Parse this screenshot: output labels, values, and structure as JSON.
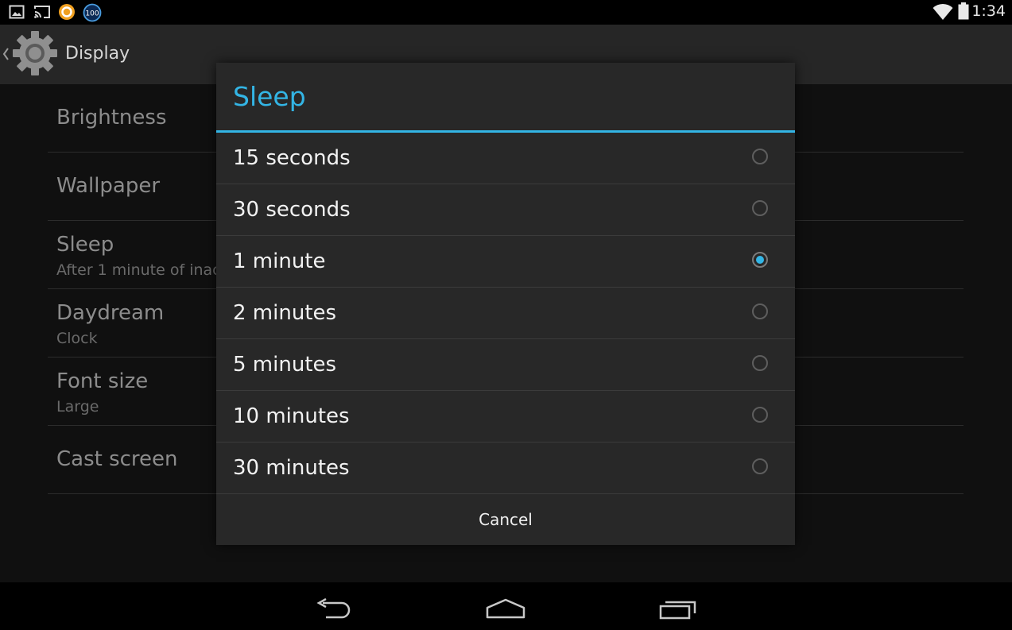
{
  "status_bar": {
    "time": "1:34",
    "left_icons": [
      "gallery-icon",
      "cast-icon",
      "app-ring-icon",
      "battery-100-badge-icon"
    ],
    "badge_text": "100",
    "right_icons": [
      "wifi-icon",
      "battery-icon"
    ]
  },
  "action_bar": {
    "title": "Display",
    "icon": "settings-gear-icon"
  },
  "settings": {
    "items": [
      {
        "title": "Brightness",
        "subtitle": ""
      },
      {
        "title": "Wallpaper",
        "subtitle": ""
      },
      {
        "title": "Sleep",
        "subtitle": "After 1 minute of inac"
      },
      {
        "title": "Daydream",
        "subtitle": "Clock"
      },
      {
        "title": "Font size",
        "subtitle": "Large"
      },
      {
        "title": "Cast screen",
        "subtitle": ""
      }
    ]
  },
  "dialog": {
    "title": "Sleep",
    "options": [
      {
        "label": "15 seconds",
        "selected": false
      },
      {
        "label": "30 seconds",
        "selected": false
      },
      {
        "label": "1 minute",
        "selected": true
      },
      {
        "label": "2 minutes",
        "selected": false
      },
      {
        "label": "5 minutes",
        "selected": false
      },
      {
        "label": "10 minutes",
        "selected": false
      },
      {
        "label": "30 minutes",
        "selected": false
      }
    ],
    "cancel_label": "Cancel"
  },
  "nav_bar": {
    "buttons": [
      "back-icon",
      "home-icon",
      "recents-icon"
    ]
  },
  "colors": {
    "accent": "#33b5e5",
    "dialog_bg": "#282828",
    "background": "#101010"
  }
}
